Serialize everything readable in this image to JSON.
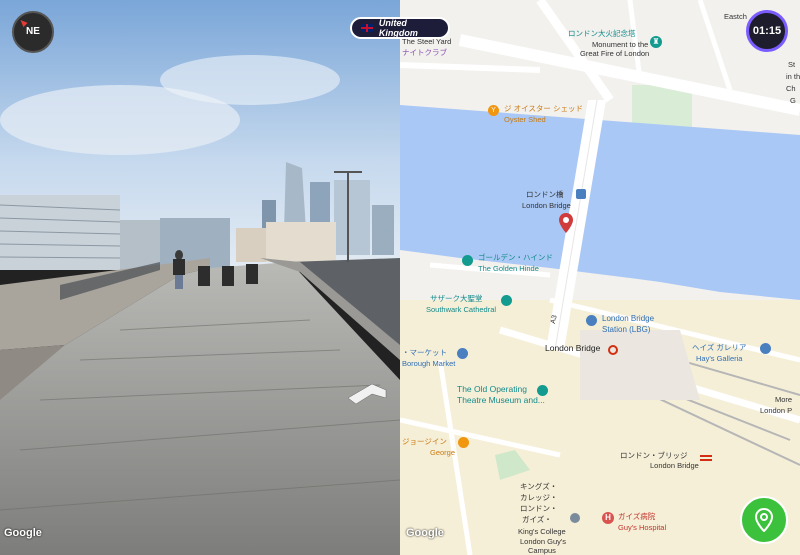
{
  "hud": {
    "compass": "NE",
    "country": "United Kingdom",
    "timer": "01:15"
  },
  "street": {
    "google": "Google"
  },
  "map": {
    "google": "Google",
    "labels": {
      "steel_yard": "The Steel Yard",
      "steel_yard_jp": "ナイトクラブ",
      "monument_jp": "ロンドン大火記念塔",
      "monument": "Monument to the",
      "monument2": "Great Fire of London",
      "eastcheap": "Eastch",
      "oyster_jp": "ジ オイスター シェッド",
      "oyster": "Oyster Shed",
      "bridge_jp": "ロンドン橋",
      "bridge": "London Bridge",
      "hinde_jp": "ゴールデン・ハインド",
      "hinde": "The Golden Hinde",
      "cathedral_jp": "サザーク大聖堂",
      "cathedral": "Southwark Cathedral",
      "station1": "London Bridge",
      "station2": "Station (LBG)",
      "a3": "A3",
      "tube": "London Bridge",
      "market_jp": "・マーケット",
      "market": "Borough Market",
      "galleria_jp": "ヘイズ ガレリア",
      "galleria": "Hay's Galleria",
      "operating1": "The Old Operating",
      "operating2": "Theatre Museum and...",
      "more1": "More",
      "more2": "London P",
      "george_jp": "ジョージイン",
      "george": "George",
      "lbridge_jp": "ロンドン・ブリッジ",
      "lbridge": "London Bridge",
      "kings_jp1": "キングズ・",
      "kings_jp2": "カレッジ・",
      "kings_jp3": "ロンドン・",
      "kings_jp4": "ガイズ・",
      "kings1": "King's College",
      "kings2": "London Guy's",
      "kings3": "Campus",
      "guys_jp": "ガイズ病院",
      "guys": "Guy's Hospital",
      "right_edge1": "St",
      "right_edge2": "in th",
      "right_edge3": "Ch",
      "right_edge4": "G"
    }
  },
  "colors": {
    "water": "#aac8f5",
    "road": "#ffffff",
    "park": "#d5ecd5",
    "accent": "#3cc13c"
  }
}
